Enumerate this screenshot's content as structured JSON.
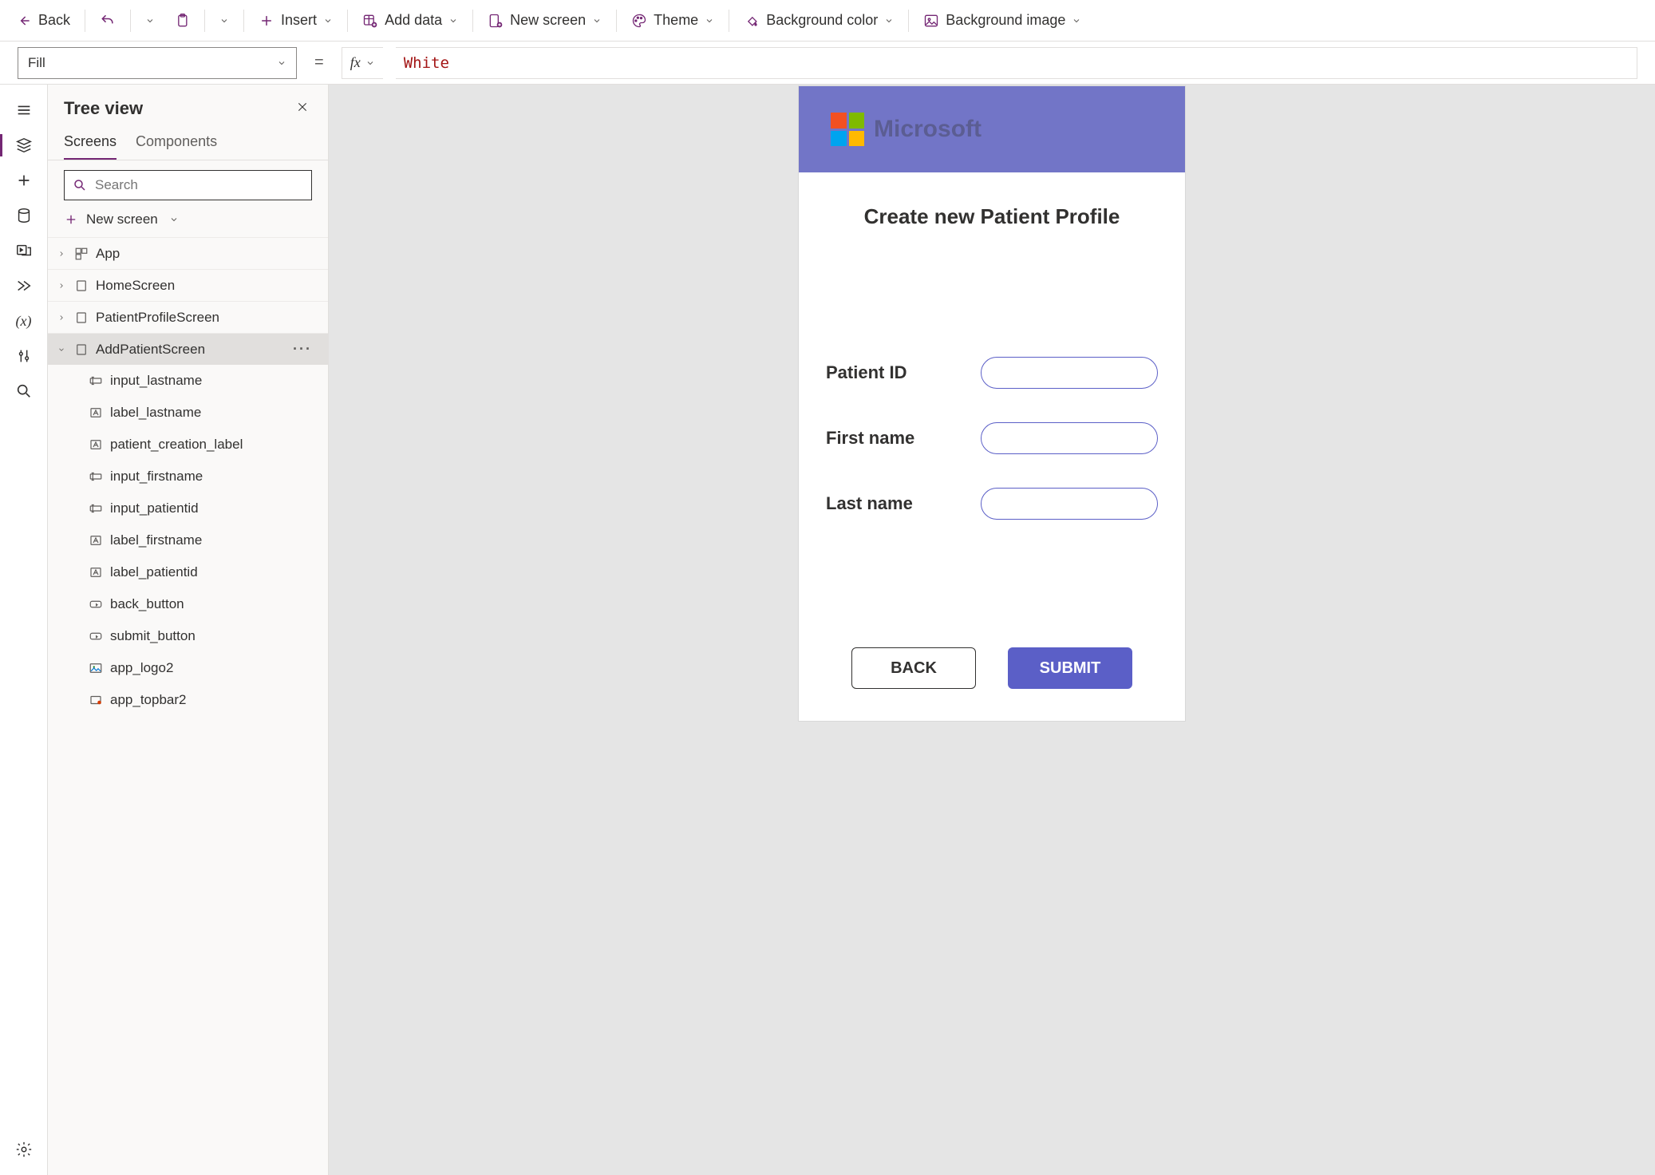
{
  "toolbar": {
    "back": "Back",
    "insert": "Insert",
    "add_data": "Add data",
    "new_screen": "New screen",
    "theme": "Theme",
    "bg_color": "Background color",
    "bg_image": "Background image"
  },
  "formula": {
    "property": "Fill",
    "value": "White"
  },
  "tree": {
    "title": "Tree view",
    "tabs": {
      "screens": "Screens",
      "components": "Components"
    },
    "search_placeholder": "Search",
    "new_screen": "New screen",
    "nodes": {
      "app": "App",
      "home": "HomeScreen",
      "patient": "PatientProfileScreen",
      "add": "AddPatientScreen",
      "children": [
        "input_lastname",
        "label_lastname",
        "patient_creation_label",
        "input_firstname",
        "input_patientid",
        "label_firstname",
        "label_patientid",
        "back_button",
        "submit_button",
        "app_logo2",
        "app_topbar2"
      ],
      "child_types": [
        "textinput",
        "label",
        "label",
        "textinput",
        "textinput",
        "label",
        "label",
        "button",
        "button",
        "image",
        "rect"
      ]
    }
  },
  "app": {
    "brand": "Microsoft",
    "title": "Create new Patient Profile",
    "labels": {
      "patientid": "Patient ID",
      "firstname": "First name",
      "lastname": "Last name"
    },
    "buttons": {
      "back": "BACK",
      "submit": "SUBMIT"
    }
  }
}
